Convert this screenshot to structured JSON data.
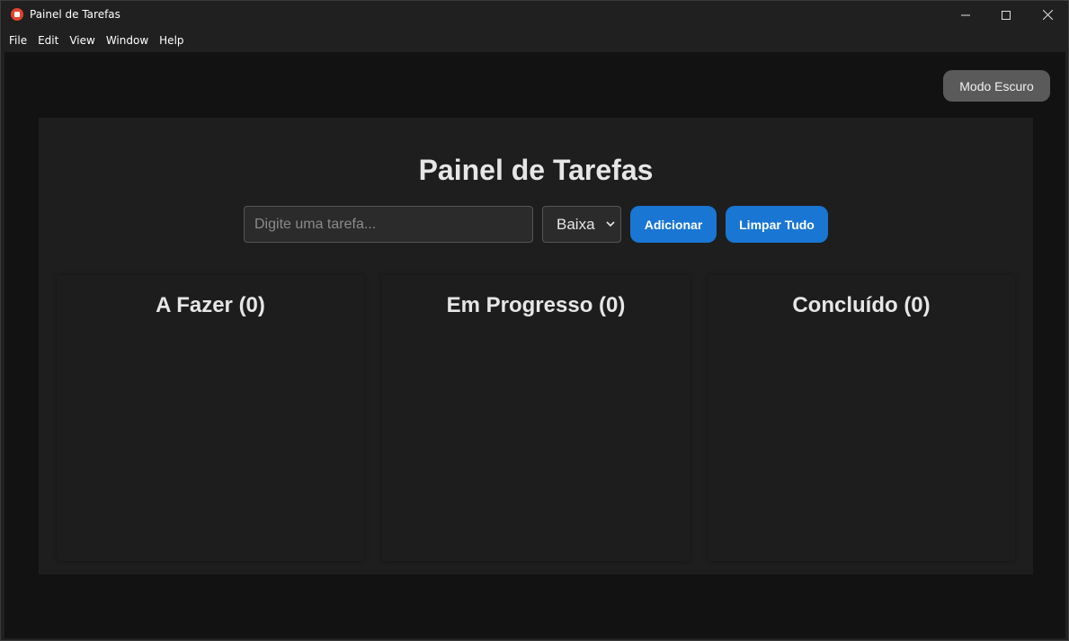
{
  "window": {
    "title": "Painel de Tarefas"
  },
  "menu": [
    "File",
    "Edit",
    "View",
    "Window",
    "Help"
  ],
  "toolbar": {
    "theme_button": "Modo Escuro"
  },
  "board": {
    "title": "Painel de Tarefas",
    "input_placeholder": "Digite uma tarefa...",
    "priority_selected": "Baixa",
    "add_button": "Adicionar",
    "clear_button": "Limpar Tudo"
  },
  "columns": [
    {
      "label": "A Fazer (0)"
    },
    {
      "label": "Em Progresso (0)"
    },
    {
      "label": "Concluído (0)"
    }
  ],
  "colors": {
    "accent": "#1976d2",
    "background": "#121212",
    "panel": "#1e1e1e"
  }
}
